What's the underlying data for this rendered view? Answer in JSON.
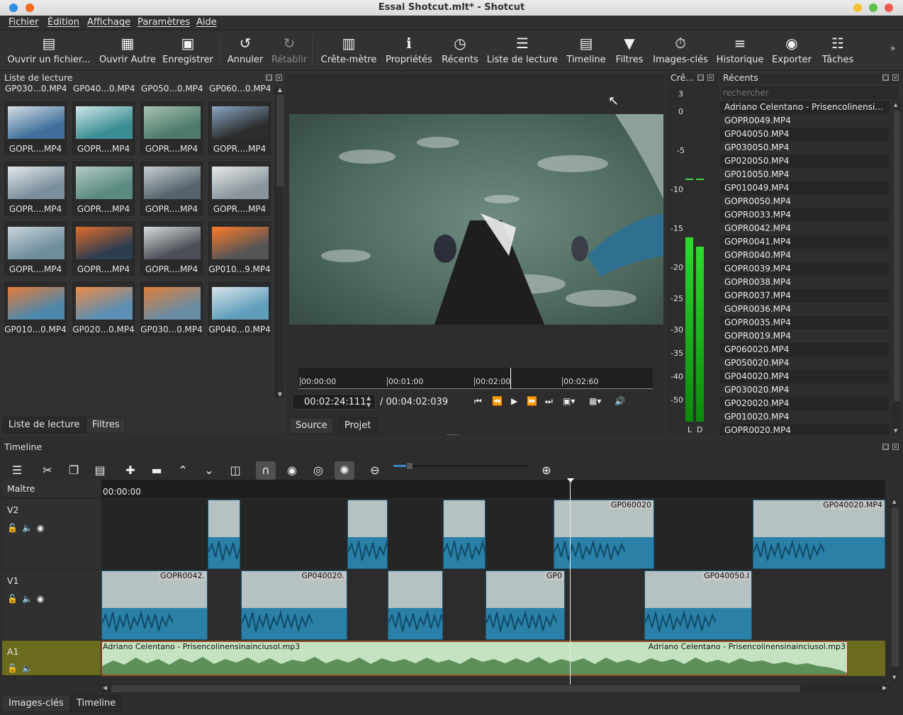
{
  "window": {
    "title": "Essai Shotcut.mlt* - Shotcut"
  },
  "menu": [
    "Fichier",
    "Édition",
    "Affichage",
    "Paramètres",
    "Aide"
  ],
  "toolbar": [
    {
      "label": "Ouvrir un fichier...",
      "icon": "open-file-icon"
    },
    {
      "label": "Ouvrir Autre",
      "icon": "open-other-icon"
    },
    {
      "label": "Enregistrer",
      "icon": "save-icon"
    },
    {
      "label": "Annuler",
      "icon": "undo-icon"
    },
    {
      "label": "Rétablir",
      "icon": "redo-icon",
      "disabled": true
    },
    {
      "label": "Crête-mètre",
      "icon": "peak-meter-icon"
    },
    {
      "label": "Propriétés",
      "icon": "properties-icon"
    },
    {
      "label": "Récents",
      "icon": "recent-icon"
    },
    {
      "label": "Liste de lecture",
      "icon": "playlist-icon"
    },
    {
      "label": "Timeline",
      "icon": "timeline-icon"
    },
    {
      "label": "Filtres",
      "icon": "filter-icon"
    },
    {
      "label": "Images-clés",
      "icon": "keyframes-icon"
    },
    {
      "label": "Historique",
      "icon": "history-icon"
    },
    {
      "label": "Exporter",
      "icon": "export-icon"
    },
    {
      "label": "Tâches",
      "icon": "jobs-icon"
    }
  ],
  "playlist": {
    "title": "Liste de lecture",
    "header_row": [
      "GP030...0.MP4",
      "GP040...0.MP4",
      "GP050...0.MP4",
      "GP060...0.MP4"
    ],
    "items": [
      "GOPR....MP4",
      "GOPR....MP4",
      "GOPR....MP4",
      "GOPR....MP4",
      "GOPR....MP4",
      "GOPR....MP4",
      "GOPR....MP4",
      "GOPR....MP4",
      "GOPR....MP4",
      "GOPR....MP4",
      "GOPR....MP4",
      "GP010...9.MP4",
      "GP010...0.MP4",
      "GP020...0.MP4",
      "GP030...0.MP4",
      "GP040...0.MP4"
    ],
    "tabs": [
      "Liste de lecture",
      "Filtres"
    ]
  },
  "viewer": {
    "ruler": [
      "00:00:00",
      "00:01:00",
      "00:02:00",
      "00:02:60"
    ],
    "current_time": "00:02:24:111",
    "total_time": "/ 00:04:02:039",
    "tabs": [
      "Source",
      "Projet"
    ]
  },
  "meter": {
    "title": "Crê...",
    "marks": [
      "3",
      "0",
      "-5",
      "-10",
      "-15",
      "-20",
      "-25",
      "-30",
      "-35",
      "-40",
      "-50"
    ],
    "channels": [
      "L",
      "D"
    ]
  },
  "recent": {
    "title": "Récents",
    "placeholder": "rechercher",
    "items": [
      "Adriano Celentano - Prisencolinensi...",
      "GOPR0049.MP4",
      "GP040050.MP4",
      "GP030050.MP4",
      "GP020050.MP4",
      "GP010050.MP4",
      "GP010049.MP4",
      "GOPR0050.MP4",
      "GOPR0033.MP4",
      "GOPR0042.MP4",
      "GOPR0041.MP4",
      "GOPR0040.MP4",
      "GOPR0039.MP4",
      "GOPR0038.MP4",
      "GOPR0037.MP4",
      "GOPR0036.MP4",
      "GOPR0035.MP4",
      "GOPR0019.MP4",
      "GP060020.MP4",
      "GP050020.MP4",
      "GP040020.MP4",
      "GP030020.MP4",
      "GP020020.MP4",
      "GP010020.MP4",
      "GOPR0020.MP4"
    ]
  },
  "timeline": {
    "title": "Timeline",
    "master": "Maître",
    "ruler_start": "00:00:00",
    "tracks": [
      "V2",
      "V1",
      "A1"
    ],
    "v2_clips": [
      "",
      "",
      "",
      "GP060020",
      "GP040020.MP4"
    ],
    "v1_clips": [
      "GOPR0042.",
      "GP040020.",
      "",
      "GP0",
      "GP040050.I"
    ],
    "a1_clips": [
      "Adriano Celentano - Prisencolinensinainciusol.mp3",
      "Adriano Celentano - Prisencolinensinainciusol.mp3"
    ],
    "tabs": [
      "Images-clés",
      "Timeline"
    ]
  }
}
